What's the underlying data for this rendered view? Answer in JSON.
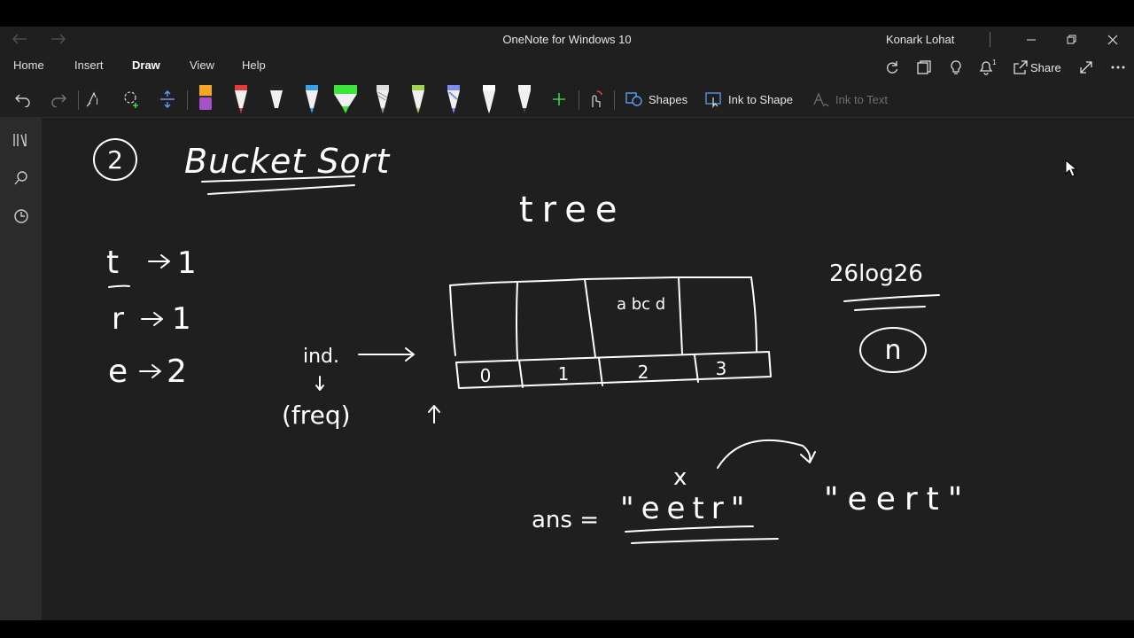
{
  "window": {
    "title": "OneNote for Windows 10",
    "user": "Konark Lohat",
    "back_icon": "back-arrow-icon",
    "forward_icon": "forward-arrow-icon"
  },
  "tabs": [
    {
      "label": "Home",
      "active": false
    },
    {
      "label": "Insert",
      "active": false
    },
    {
      "label": "Draw",
      "active": true
    },
    {
      "label": "View",
      "active": false
    },
    {
      "label": "Help",
      "active": false
    }
  ],
  "right_toolbar": {
    "notification_count": "1",
    "share_label": "Share",
    "icons": [
      "sync-icon",
      "pages-icon",
      "lightbulb-icon",
      "bell-icon",
      "share-icon",
      "expand-icon",
      "more-icon"
    ]
  },
  "ribbon": {
    "tools": [
      "undo-icon",
      "redo-icon",
      "lasso-select-icon",
      "lasso-icon",
      "add-space-icon"
    ],
    "pens": [
      {
        "name": "highlighter-orange-purple",
        "colors": [
          "#f5a623",
          "#a452c9"
        ]
      },
      {
        "name": "pen-red",
        "colors": [
          "#e83a3a"
        ]
      },
      {
        "name": "pen-black",
        "colors": [
          "#222222"
        ]
      },
      {
        "name": "pen-blue",
        "colors": [
          "#3aa0e8"
        ]
      },
      {
        "name": "highlighter-green",
        "colors": [
          "#39e639"
        ]
      },
      {
        "name": "pen-pattern-white",
        "colors": [
          "#dddddd"
        ]
      },
      {
        "name": "pen-lime",
        "colors": [
          "#9fd64b"
        ]
      },
      {
        "name": "pen-galaxy",
        "colors": [
          "#7d8cf0"
        ]
      },
      {
        "name": "pen-white",
        "colors": [
          "#ffffff"
        ]
      },
      {
        "name": "pen-white-2",
        "colors": [
          "#f2f2f2"
        ]
      }
    ],
    "add_pen_icon": "plus-icon",
    "touch_draw_icon": "touch-draw-icon",
    "shapes_label": "Shapes",
    "ink_to_shape_label": "Ink to Shape",
    "ink_to_text_label": "Ink to Text"
  },
  "left_nav": [
    "notebooks-icon",
    "search-icon",
    "recent-icon"
  ],
  "note": {
    "step_number": "2",
    "heading": "Bucket Sort",
    "input_word": "tree",
    "frequency_map": [
      {
        "char": "t",
        "count": "1"
      },
      {
        "char": "r",
        "count": "1"
      },
      {
        "char": "e",
        "count": "2"
      }
    ],
    "index_label": "ind.",
    "freq_label": "(freq)",
    "bucket_indices": [
      "0",
      "1",
      "2",
      "3"
    ],
    "bucket_contents": [
      "",
      "",
      "a bc d",
      ""
    ],
    "complexity": "26log26",
    "complexity_alt": "n",
    "answer_label": "ans =",
    "answer_crossed": "\"eetr\"",
    "answer_mark": "x",
    "answer_final": "\"eert\""
  },
  "colors": {
    "app_bg": "#1f1f1f",
    "nav_bg": "#2b2b2b",
    "accent": "#8ea4ff",
    "ink": "#ffffff"
  }
}
